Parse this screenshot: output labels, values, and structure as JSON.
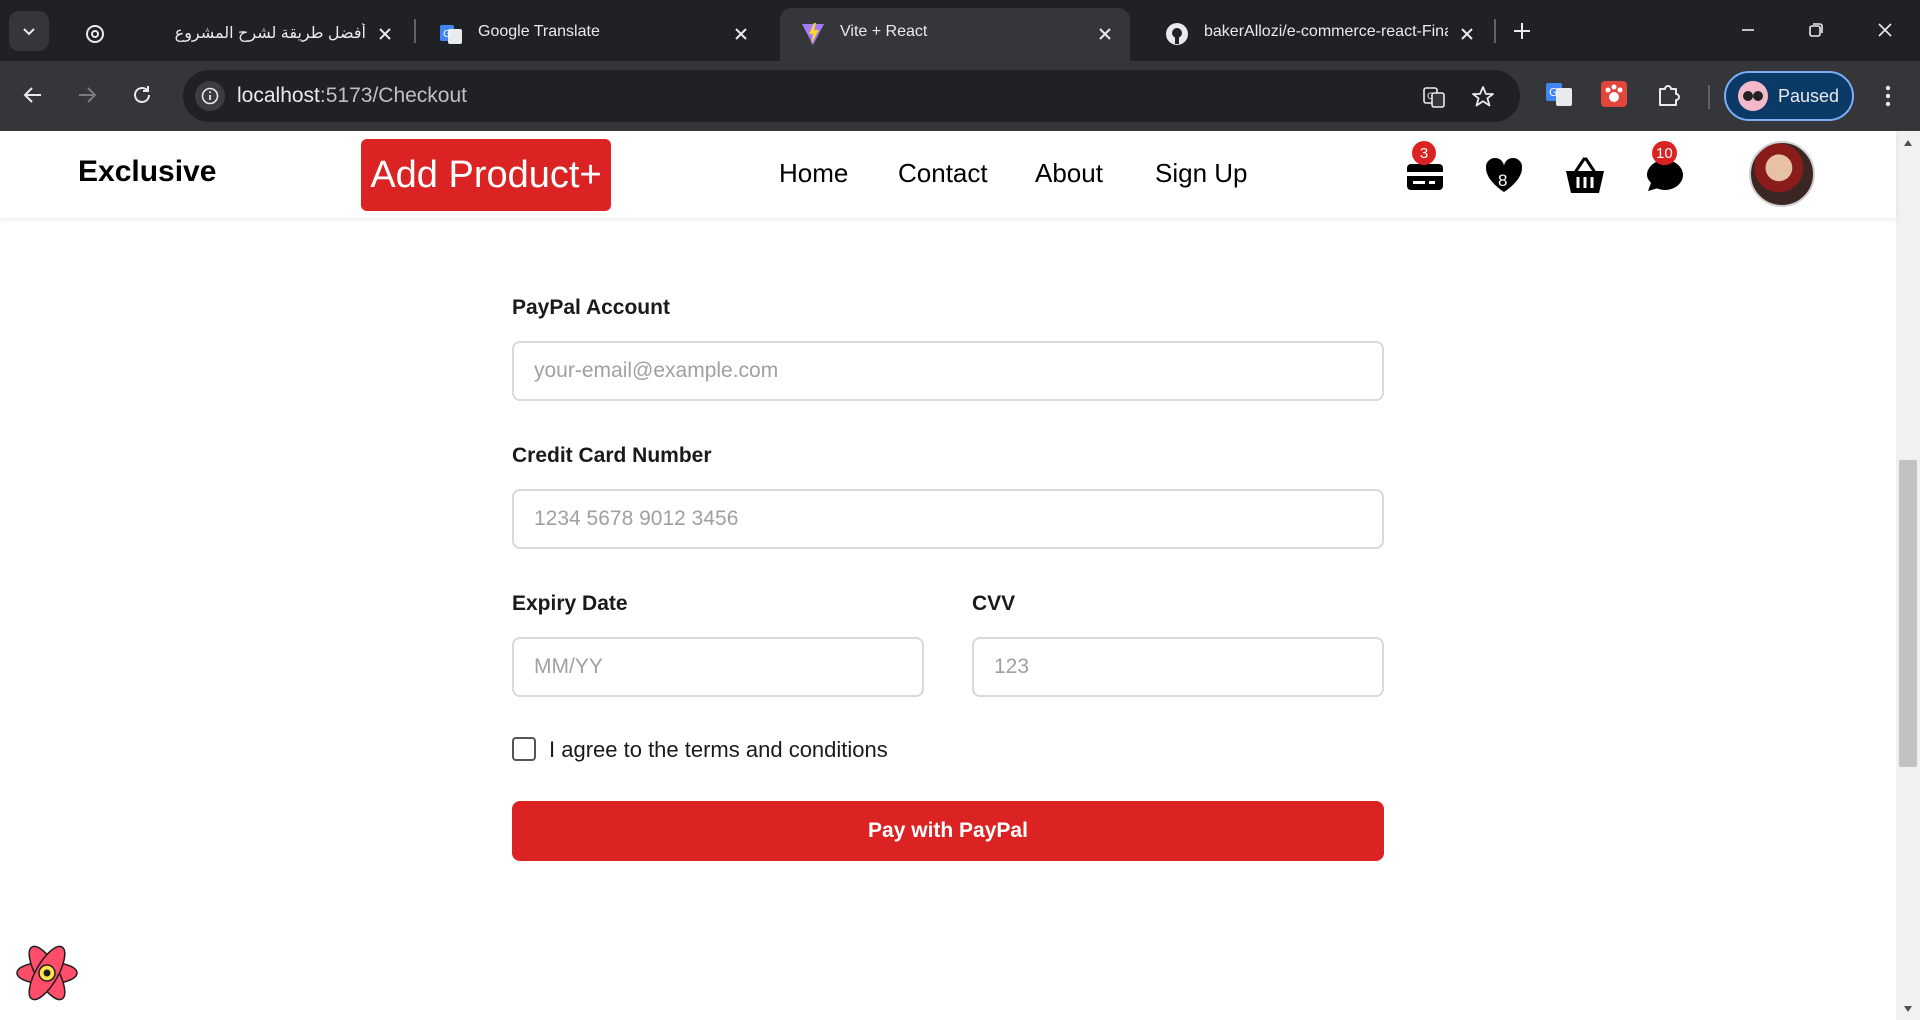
{
  "browser": {
    "tabs": [
      {
        "title": "أفضل طريقة لشرح المشروع",
        "icon": "chatgpt-icon"
      },
      {
        "title": "Google Translate",
        "icon": "google-translate-icon"
      },
      {
        "title": "Vite + React",
        "icon": "vite-icon",
        "active": true
      },
      {
        "title": "bakerAllozi/e-commerce-react-Final-w",
        "icon": "github-icon"
      }
    ],
    "url_host": "localhost",
    "url_rest": ":5173/Checkout",
    "profile_label": "Paused"
  },
  "site": {
    "brand": "Exclusive",
    "add_product_label": "Add Product+",
    "nav_links": [
      "Home",
      "Contact",
      "About",
      "Sign Up"
    ],
    "cart_badge": "3",
    "wishlist_count": "8",
    "messages_badge": "10",
    "accent_color": "#db2323"
  },
  "form": {
    "paypal_label": "PayPal Account",
    "paypal_placeholder": "your-email@example.com",
    "card_label": "Credit Card Number",
    "card_placeholder": "1234 5678 9012 3456",
    "expiry_label": "Expiry Date",
    "expiry_placeholder": "MM/YY",
    "cvv_label": "CVV",
    "cvv_placeholder": "123",
    "terms_label": "I agree to the terms and conditions",
    "pay_button": "Pay with PayPal"
  }
}
